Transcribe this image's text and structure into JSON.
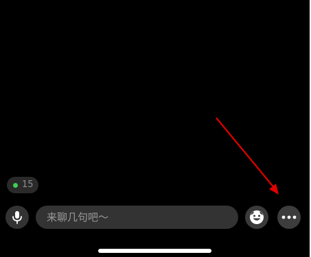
{
  "viewers": {
    "count": "15",
    "dot_color": "#3fd14e",
    "icon": "live-dot-icon"
  },
  "input_bar": {
    "mic_icon": "microphone-icon",
    "placeholder": "来聊几句吧～",
    "emoji_icon": "smiley-face-icon",
    "more_icon": "more-dots-icon"
  },
  "annotation": {
    "type": "arrow",
    "color": "#e00000",
    "points_to": "more-button"
  }
}
